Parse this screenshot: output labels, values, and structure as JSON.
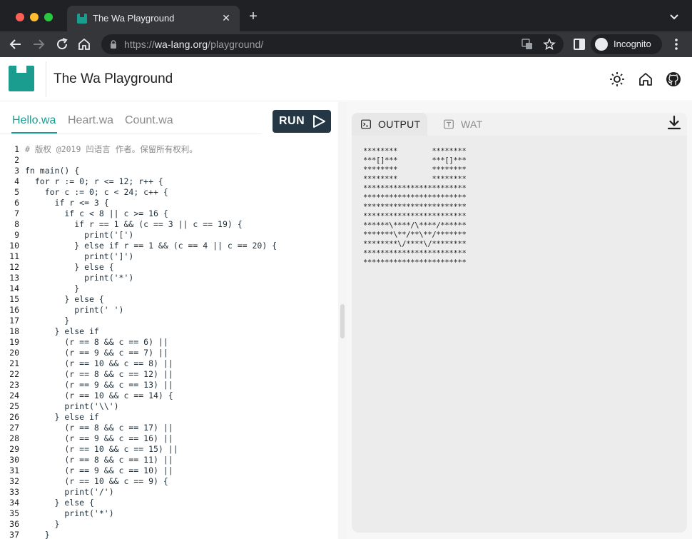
{
  "browser": {
    "tab_title": "The Wa Playground",
    "tab_close": "✕",
    "new_tab": "+",
    "url_scheme": "https://",
    "url_host": "wa-lang.org",
    "url_path": "/playground/",
    "incognito_label": "Incognito"
  },
  "header": {
    "title": "The Wa Playground",
    "icons": [
      "sun-icon",
      "home-icon",
      "github-icon"
    ]
  },
  "editor": {
    "file_tabs": [
      {
        "label": "Hello.wa",
        "active": true
      },
      {
        "label": "Heart.wa",
        "active": false
      },
      {
        "label": "Count.wa",
        "active": false
      }
    ],
    "run_label": "RUN",
    "lines": [
      {
        "n": "1",
        "code": "# 版权 @2019 凹语言 作者。保留所有权利。"
      },
      {
        "n": "2",
        "code": ""
      },
      {
        "n": "3",
        "code": "fn main() {"
      },
      {
        "n": "4",
        "code": "  for r := 0; r <= 12; r++ {"
      },
      {
        "n": "5",
        "code": "    for c := 0; c < 24; c++ {"
      },
      {
        "n": "6",
        "code": "      if r <= 3 {"
      },
      {
        "n": "7",
        "code": "        if c < 8 || c >= 16 {"
      },
      {
        "n": "8",
        "code": "          if r == 1 && (c == 3 || c == 19) {"
      },
      {
        "n": "9",
        "code": "            print('[')"
      },
      {
        "n": "10",
        "code": "          } else if r == 1 && (c == 4 || c == 20) {"
      },
      {
        "n": "11",
        "code": "            print(']')"
      },
      {
        "n": "12",
        "code": "          } else {"
      },
      {
        "n": "13",
        "code": "            print('*')"
      },
      {
        "n": "14",
        "code": "          }"
      },
      {
        "n": "15",
        "code": "        } else {"
      },
      {
        "n": "16",
        "code": "          print(' ')"
      },
      {
        "n": "17",
        "code": "        }"
      },
      {
        "n": "18",
        "code": "      } else if"
      },
      {
        "n": "19",
        "code": "        (r == 8 && c == 6) ||"
      },
      {
        "n": "20",
        "code": "        (r == 9 && c == 7) ||"
      },
      {
        "n": "21",
        "code": "        (r == 10 && c == 8) ||"
      },
      {
        "n": "22",
        "code": "        (r == 8 && c == 12) ||"
      },
      {
        "n": "23",
        "code": "        (r == 9 && c == 13) ||"
      },
      {
        "n": "24",
        "code": "        (r == 10 && c == 14) {"
      },
      {
        "n": "25",
        "code": "        print('\\\\')"
      },
      {
        "n": "26",
        "code": "      } else if"
      },
      {
        "n": "27",
        "code": "        (r == 8 && c == 17) ||"
      },
      {
        "n": "28",
        "code": "        (r == 9 && c == 16) ||"
      },
      {
        "n": "29",
        "code": "        (r == 10 && c == 15) ||"
      },
      {
        "n": "30",
        "code": "        (r == 8 && c == 11) ||"
      },
      {
        "n": "31",
        "code": "        (r == 9 && c == 10) ||"
      },
      {
        "n": "32",
        "code": "        (r == 10 && c == 9) {"
      },
      {
        "n": "33",
        "code": "        print('/')"
      },
      {
        "n": "34",
        "code": "      } else {"
      },
      {
        "n": "35",
        "code": "        print('*')"
      },
      {
        "n": "36",
        "code": "      }"
      },
      {
        "n": "37",
        "code": "    }"
      }
    ]
  },
  "output": {
    "tabs": [
      {
        "label": "OUTPUT",
        "active": true
      },
      {
        "label": "WAT",
        "active": false
      }
    ],
    "lines": [
      "********        ********",
      "***[]***        ***[]***",
      "********        ********",
      "********        ********",
      "************************",
      "************************",
      "************************",
      "************************",
      "******\\****/\\****/******",
      "*******\\**/**\\**/*******",
      "********\\/****\\/********",
      "************************",
      "************************"
    ]
  },
  "colors": {
    "brand": "#1a9d8f",
    "run_button": "#253745"
  }
}
